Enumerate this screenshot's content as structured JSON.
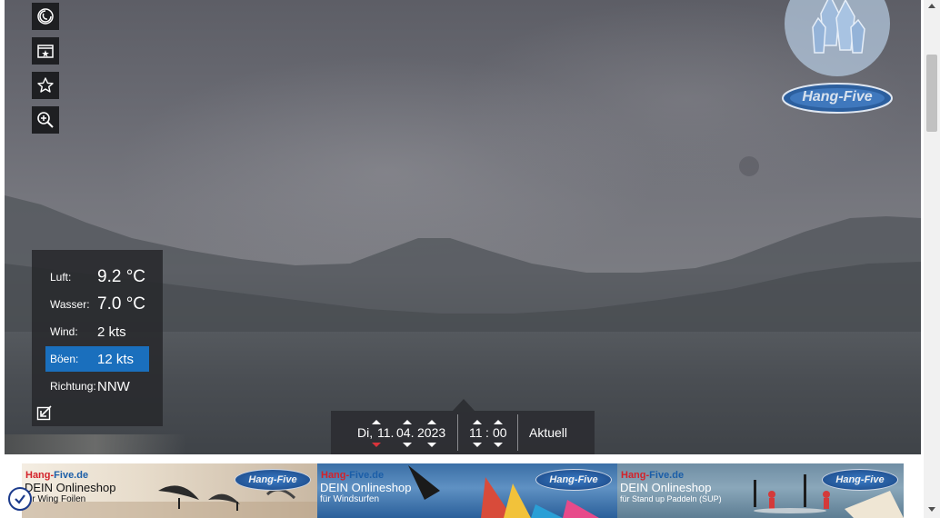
{
  "toolbar": {
    "buttons": [
      {
        "icon": "timelapse-icon"
      },
      {
        "icon": "picture-in-picture-icon"
      },
      {
        "icon": "star-icon"
      },
      {
        "icon": "zoom-in-icon"
      }
    ]
  },
  "logo": {
    "text": "Hang-Five"
  },
  "weather": {
    "rows": [
      {
        "label": "Luft:",
        "value": "9.2 °C"
      },
      {
        "label": "Wasser:",
        "value": "7.0 °C"
      },
      {
        "label": "Wind:",
        "value": "2 kts"
      },
      {
        "label": "Böen:",
        "value": "12 kts"
      },
      {
        "label": "Richtung:",
        "value": "NNW"
      }
    ],
    "highlight_color": "#1a6fbd"
  },
  "timenav": {
    "weekday": "Di,",
    "day": "11.",
    "month": "04.",
    "year": "2023",
    "hour": "11",
    "separator": ":",
    "minute": "00",
    "current_label": "Aktuell"
  },
  "banner": {
    "ads": [
      {
        "brand_red": "Hang-",
        "brand_blue": "Five.de",
        "headline": "DEIN Onlineshop",
        "sub": "für Wing Foilen",
        "logo": "Hang-Five"
      },
      {
        "brand_red": "Hang-",
        "brand_blue": "Five.de",
        "headline": "DEIN Onlineshop",
        "sub": "für Windsurfen",
        "logo": "Hang-Five"
      },
      {
        "brand_red": "Hang-",
        "brand_blue": "Five.de",
        "headline": "DEIN Onlineshop",
        "sub": "für Stand up Paddeln (SUP)",
        "logo": "Hang-Five"
      }
    ]
  },
  "colors": {
    "panel": "#28292c",
    "accent_blue": "#1a6fbd",
    "date_marker": "#d9333a"
  }
}
